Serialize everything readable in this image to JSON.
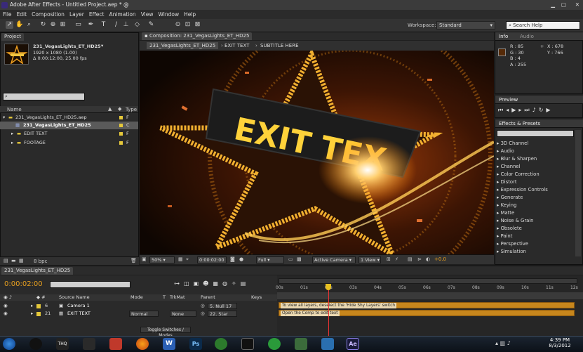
{
  "window": {
    "title": "Adobe After Effects - Untitled Project.aep * @"
  },
  "menu": [
    "File",
    "Edit",
    "Composition",
    "Layer",
    "Effect",
    "Animation",
    "View",
    "Window",
    "Help"
  ],
  "workspace": {
    "label": "Workspace:",
    "value": "Standard"
  },
  "search_help": {
    "placeholder": "Search Help"
  },
  "project": {
    "tab": "Project",
    "selected_name": "231_VegasLights_ET_HD25",
    "resolution": "1920 x 1080 (1.00)",
    "duration": "Δ 0:00:12:00, 25.00 fps",
    "col_name": "Name",
    "col_type": "Type",
    "items": [
      {
        "name": "231_VegasLights_ET_HD25.aep",
        "type": "F"
      },
      {
        "name": "231_VegasLights_ET_HD25",
        "type": "C"
      },
      {
        "name": "EDIT TEXT",
        "type": "F"
      },
      {
        "name": "FOOTAGE",
        "type": "F"
      }
    ],
    "bpc": "8 bpc"
  },
  "composition": {
    "tab": "Composition: 231_VegasLights_ET_HD25",
    "crumbs": [
      "231_VegasLights_ET_HD25",
      "EXIT TEXT",
      "SUBTITLE HERE"
    ],
    "viewer_text": "EXIT TEX",
    "zoom": "50%",
    "timecode": "0:00:02:00",
    "resolution": "Full",
    "camera": "Active Camera",
    "views": "1 View",
    "exposure": "+0.0"
  },
  "info": {
    "tab_info": "Info",
    "tab_audio": "Audio",
    "r": "R : 85",
    "g": "G : 30",
    "b": "B : 4",
    "a": "A : 255",
    "x": "X : 678",
    "y": "Y : 766",
    "color": "#552a08"
  },
  "preview": {
    "tab": "Preview"
  },
  "effects": {
    "tab": "Effects & Presets",
    "items": [
      "3D Channel",
      "Audio",
      "Blur & Sharpen",
      "Channel",
      "Color Correction",
      "Distort",
      "Expression Controls",
      "Generate",
      "Keying",
      "Matte",
      "Noise & Grain",
      "Obsolete",
      "Paint",
      "Perspective",
      "Simulation"
    ]
  },
  "timeline": {
    "tab": "231_VegasLights_ET_HD25",
    "timecode": "0:00:02:00",
    "headers": {
      "source": "Source Name",
      "mode": "Mode",
      "t": "T",
      "trkmat": "TrkMat",
      "parent": "Parent",
      "keys": "Keys"
    },
    "layers": [
      {
        "num": "6",
        "name": "Camera 1",
        "mode": "",
        "trkmat": "",
        "parent": "5. Null 17",
        "note": "To view all layers, deselect the 'Hide Shy Layers' switch"
      },
      {
        "num": "21",
        "name": "EXIT TEXT",
        "mode": "Normal",
        "trkmat": "None",
        "parent": "22. Star",
        "note": "Open the Comp to edit text"
      }
    ],
    "ruler": [
      "00s",
      "01s",
      "02s",
      "03s",
      "04s",
      "05s",
      "06s",
      "07s",
      "08s",
      "09s",
      "10s",
      "11s",
      "12s"
    ],
    "toggle": "Toggle Switches / Modes",
    "playhead_seconds": 2,
    "duration_seconds": 12
  },
  "taskbar": {
    "time": "4:39 PM",
    "date": "8/3/2012"
  },
  "colors": {
    "accent": "#e8a020",
    "label_yellow": "#e5c83a",
    "layer_bar": "#c7861c",
    "selection": "#5a5a5a"
  }
}
